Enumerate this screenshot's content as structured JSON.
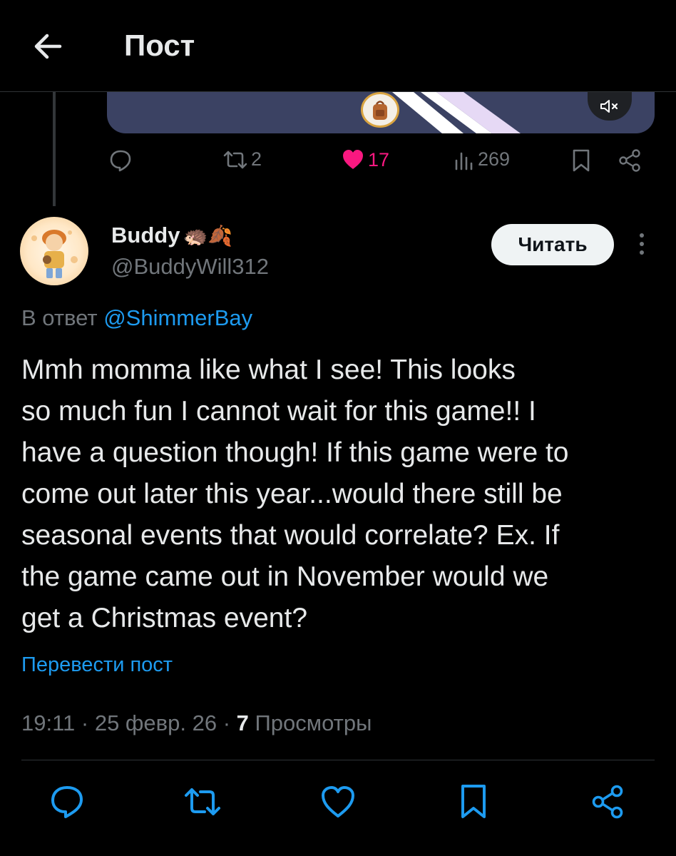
{
  "header": {
    "title": "Пост"
  },
  "previous_post": {
    "actions": {
      "reposts": "2",
      "likes": "17",
      "views": "269"
    }
  },
  "post": {
    "display_name": "Buddy",
    "name_emojis": "🦔🍂",
    "handle": "@BuddyWill312",
    "follow_label": "Читать",
    "reply_prefix": "В ответ",
    "reply_mention": "@ShimmerBay",
    "text": "Mmh momma like what I see! This looks\nso much fun I cannot wait for this game!! I\nhave a question though! If this game were to\ncome out later this year...would there still be\nseasonal events that would correlate? Ex. If\nthe game came out in November would we\nget a Christmas event?",
    "translate_label": "Перевести пост",
    "timestamp": "19:11 · 25 февр. 26 · ",
    "views_count": "7",
    "views_label": " Просмотры"
  },
  "colors": {
    "background": "#000000",
    "text": "#e7e9ea",
    "secondary_text": "#71767b",
    "link": "#1d9bf0",
    "like": "#f91880"
  },
  "icons": {
    "header": [
      "arrow-left-icon"
    ],
    "media": [
      "backpack-icon",
      "mute-icon"
    ],
    "actions": [
      "reply-icon",
      "repost-icon",
      "heart-icon",
      "views-icon",
      "bookmark-icon",
      "share-icon"
    ],
    "post": [
      "avatar",
      "more-vertical-icon"
    ]
  }
}
